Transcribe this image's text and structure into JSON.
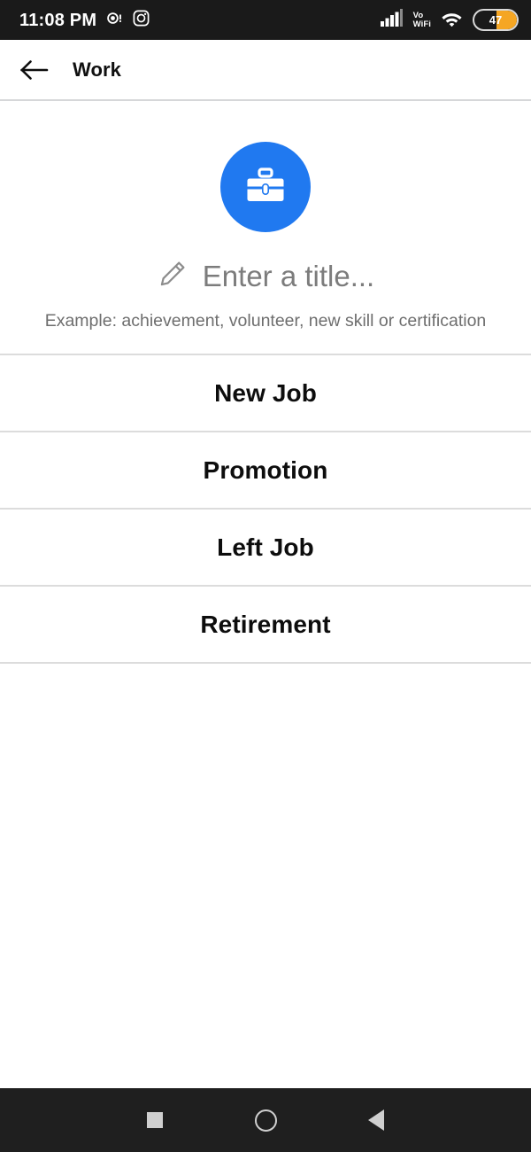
{
  "status_bar": {
    "time": "11:08 PM",
    "notification_icon": "notification-dot-icon",
    "instagram_icon": "instagram-icon",
    "signal_icon": "cellular-signal-icon",
    "network_label_line1": "Vo",
    "network_label_line2": "WiFi",
    "wifi_icon": "wifi-icon",
    "battery_percent": "47",
    "battery_level": 47,
    "background_color": "#1a1a1a"
  },
  "app_bar": {
    "back_icon": "back-arrow-icon",
    "title": "Work"
  },
  "header": {
    "avatar_icon": "briefcase-icon",
    "avatar_color": "#2079f0",
    "edit_icon": "pencil-icon",
    "title_placeholder": "Enter a title...",
    "example_hint": "Example: achievement, volunteer, new skill or certification"
  },
  "options": [
    {
      "label": "New Job"
    },
    {
      "label": "Promotion"
    },
    {
      "label": "Left Job"
    },
    {
      "label": "Retirement"
    }
  ],
  "nav_bar": {
    "recents_icon": "recents-square-icon",
    "home_icon": "home-circle-icon",
    "back_icon": "back-triangle-icon",
    "background_color": "#1f1f1f"
  }
}
